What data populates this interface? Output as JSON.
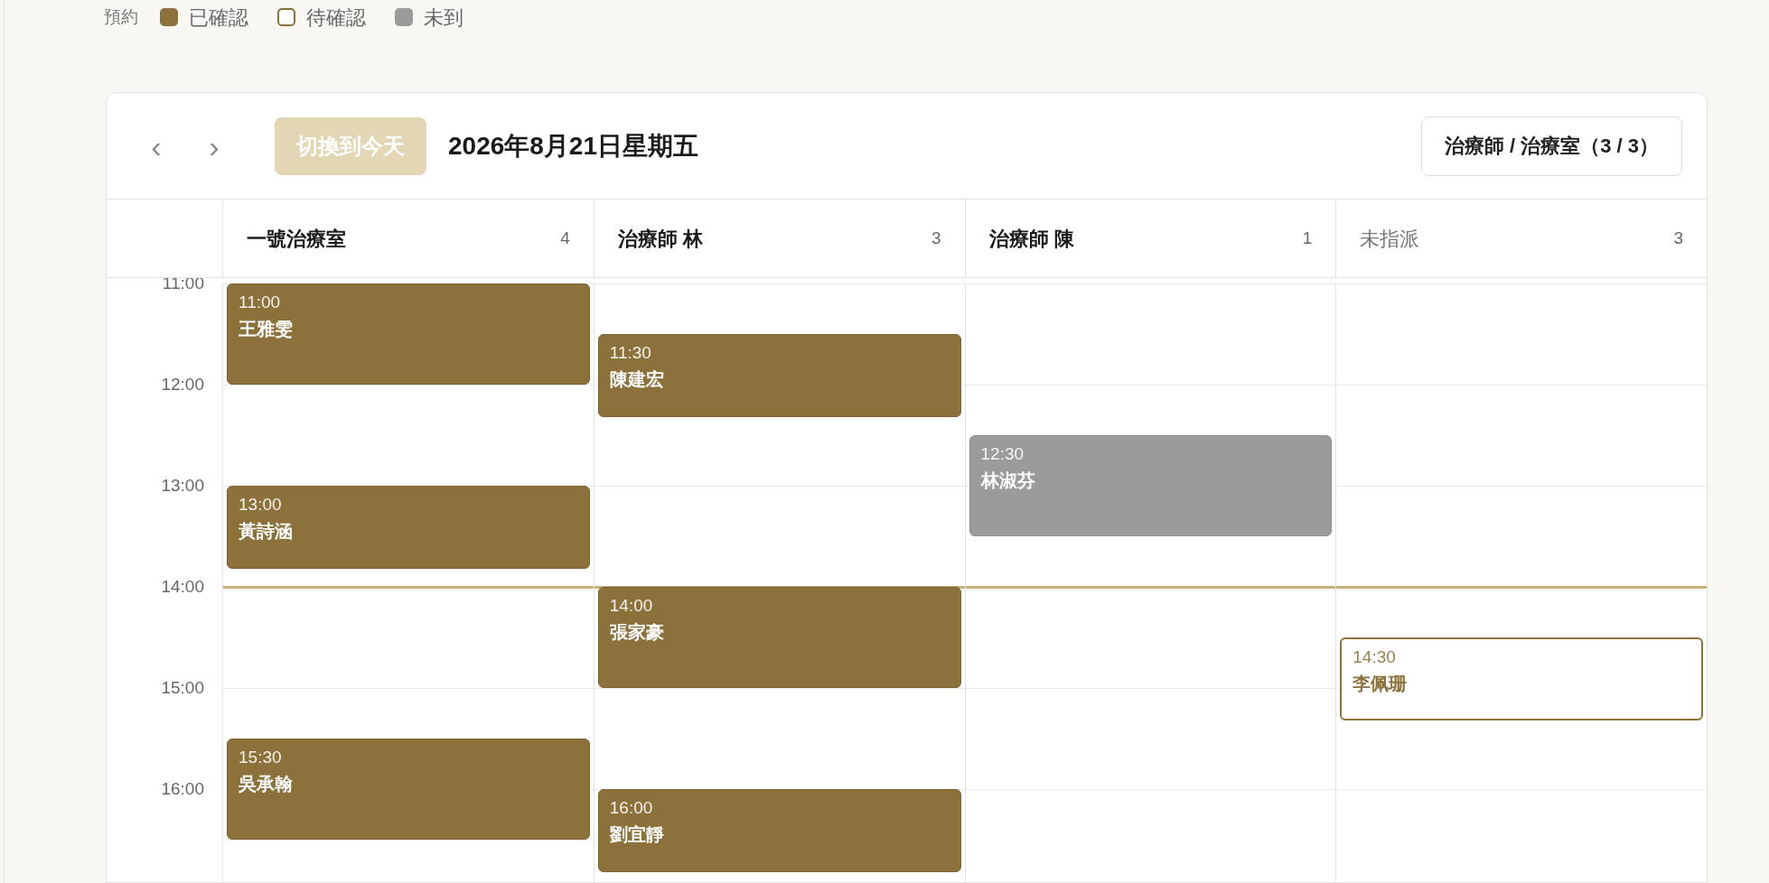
{
  "legend": {
    "label": "預約",
    "items": [
      {
        "kind": "confirmed",
        "label": "已確認"
      },
      {
        "kind": "pending",
        "label": "待確認"
      },
      {
        "kind": "absent",
        "label": "未到"
      }
    ]
  },
  "toolbar": {
    "prev": "‹",
    "next": "›",
    "today_button": "切換到今天",
    "date": "2026年8月21日星期五",
    "filter_button": "治療師 / 治療室（3 / 3）"
  },
  "hours": [
    {
      "label": "11:00",
      "current": false
    },
    {
      "label": "12:00",
      "current": false
    },
    {
      "label": "13:00",
      "current": false
    },
    {
      "label": "14:00",
      "current": true
    },
    {
      "label": "15:00",
      "current": false
    },
    {
      "label": "16:00",
      "current": false
    }
  ],
  "columns": [
    {
      "name": "一號治療室",
      "count": "4",
      "assigned": true,
      "events": [
        {
          "time": "11:00",
          "name": "王雅雯",
          "kind": "confirmed",
          "short": false
        },
        {
          "time": "13:00",
          "name": "黃詩涵",
          "kind": "confirmed",
          "short": true
        },
        {
          "time": "15:30",
          "name": "吳承翰",
          "kind": "confirmed",
          "short": false
        }
      ]
    },
    {
      "name": "治療師 林",
      "count": "3",
      "assigned": true,
      "events": [
        {
          "time": "11:30",
          "name": "陳建宏",
          "kind": "confirmed",
          "short": true
        },
        {
          "time": "14:00",
          "name": "張家豪",
          "kind": "confirmed",
          "short": false
        },
        {
          "time": "16:00",
          "name": "劉宜靜",
          "kind": "confirmed",
          "short": true
        }
      ]
    },
    {
      "name": "治療師 陳",
      "count": "1",
      "assigned": true,
      "events": [
        {
          "time": "12:30",
          "name": "林淑芬",
          "kind": "absent",
          "short": false
        }
      ]
    },
    {
      "name": "未指派",
      "count": "3",
      "assigned": false,
      "events": [
        {
          "time": "14:30",
          "name": "李佩珊",
          "kind": "pending",
          "short": true
        }
      ]
    }
  ]
}
